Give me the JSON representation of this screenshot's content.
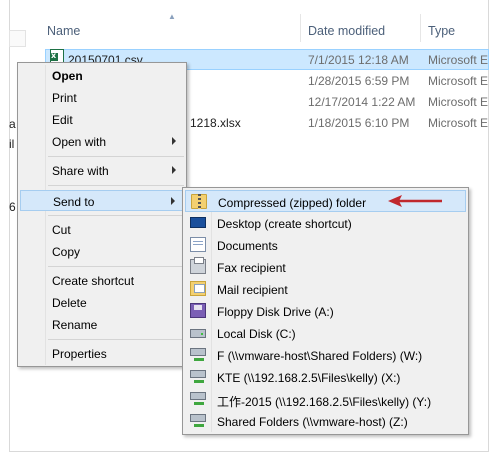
{
  "header": {
    "name": "Name",
    "date_modified": "Date modified",
    "type": "Type"
  },
  "files": [
    {
      "name": "20150701.csv",
      "date": "7/1/2015 12:18 AM",
      "type": "Microsoft E"
    },
    {
      "name": "",
      "date": "1/28/2015 6:59 PM",
      "type": "Microsoft E"
    },
    {
      "name": "",
      "date": "12/17/2014 1:22 AM",
      "type": "Microsoft E"
    },
    {
      "name": "1218.xlsx",
      "date": "1/18/2015 6:10 PM",
      "type": "Microsoft E"
    }
  ],
  "left_clipped": [
    "a",
    "il",
    "6"
  ],
  "context_menu": {
    "items": [
      "Open",
      "Print",
      "Edit",
      "Open with",
      "Share with",
      "Send to",
      "Cut",
      "Copy",
      "Create shortcut",
      "Delete",
      "Rename",
      "Properties"
    ]
  },
  "send_to_menu": {
    "items": [
      {
        "label": "Compressed (zipped) folder",
        "icon": "zip-folder-icon"
      },
      {
        "label": "Desktop (create shortcut)",
        "icon": "desktop-icon"
      },
      {
        "label": "Documents",
        "icon": "documents-icon"
      },
      {
        "label": "Fax recipient",
        "icon": "fax-icon"
      },
      {
        "label": "Mail recipient",
        "icon": "mail-icon"
      },
      {
        "label": "Floppy Disk Drive (A:)",
        "icon": "floppy-icon"
      },
      {
        "label": "Local Disk (C:)",
        "icon": "local-disk-icon"
      },
      {
        "label": "F (\\\\vmware-host\\Shared Folders) (W:)",
        "icon": "network-drive-icon"
      },
      {
        "label": "KTE (\\\\192.168.2.5\\Files\\kelly) (X:)",
        "icon": "network-drive-icon"
      },
      {
        "label": "工作-2015 (\\\\192.168.2.5\\Files\\kelly) (Y:)",
        "icon": "network-drive-icon"
      },
      {
        "label": "Shared Folders (\\\\vmware-host) (Z:)",
        "icon": "network-drive-icon"
      }
    ]
  },
  "colors": {
    "selection": "#cce8ff",
    "menu_hover": "#d5e8fa",
    "arrow": "#c0282d"
  }
}
